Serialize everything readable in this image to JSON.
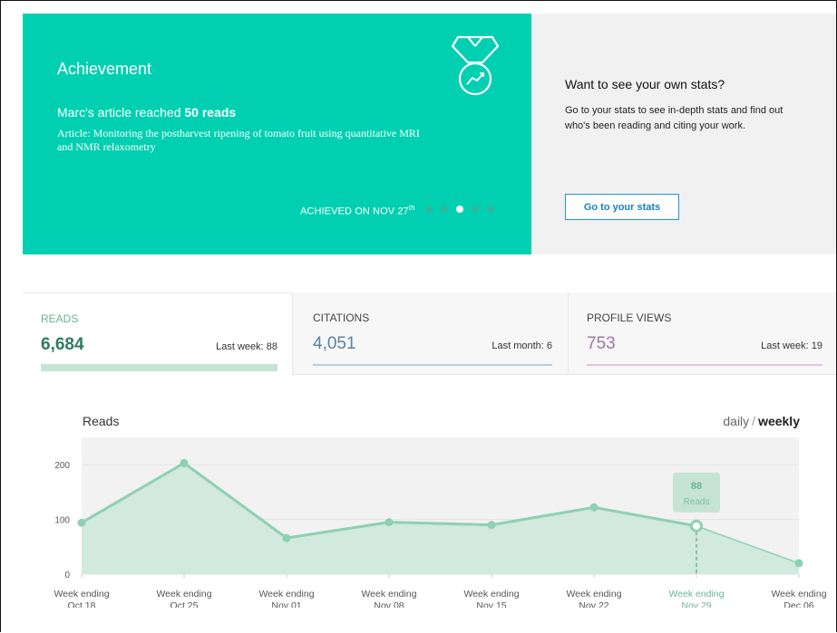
{
  "achievement": {
    "title": "Achievement",
    "headline_prefix": "Marc's article reached ",
    "headline_bold": "50 reads",
    "article": "Article: Monitoring the postharvest ripening of tomato fruit using quantitative MRI and NMR relaxometry",
    "achieved_prefix": "ACHIEVED ON NOV 27",
    "achieved_suffix": "th",
    "slides_total": 5,
    "slide_active": 3,
    "icon": "medal-chart-icon"
  },
  "promo": {
    "title": "Want to see your own stats?",
    "text": "Go to your stats to see in-depth stats and find out who's been reading and citing your work.",
    "button": "Go to your stats"
  },
  "tabs": [
    {
      "label": "READS",
      "value": "6,684",
      "meta": "Last week: 88",
      "color": "#2f7b5f"
    },
    {
      "label": "CITATIONS",
      "value": "4,051",
      "meta": "Last month: 6",
      "color": "#5d7fa2"
    },
    {
      "label": "PROFILE VIEWS",
      "value": "753",
      "meta": "Last week: 19",
      "color": "#a672ad"
    }
  ],
  "chart": {
    "title": "Reads",
    "toggle_daily": "daily",
    "toggle_sep": "/",
    "toggle_weekly": "weekly",
    "tooltip_value": "88",
    "tooltip_label": "Reads"
  },
  "chart_data": {
    "type": "area",
    "title": "Reads",
    "categories": [
      [
        "Week ending",
        "Oct 18"
      ],
      [
        "Week ending",
        "Oct 25"
      ],
      [
        "Week ending",
        "Nov 01"
      ],
      [
        "Week ending",
        "Nov 08"
      ],
      [
        "Week ending",
        "Nov 15"
      ],
      [
        "Week ending",
        "Nov 22"
      ],
      [
        "Week ending",
        "Nov 29"
      ],
      [
        "Week ending",
        "Dec 06"
      ]
    ],
    "values": [
      94,
      203,
      66,
      95,
      90,
      122,
      88,
      20
    ],
    "highlight_index": 6,
    "ylim": [
      0,
      250
    ],
    "yticks": [
      0,
      100,
      200
    ],
    "colors": {
      "line": "#8fd0b3",
      "fill": "#d2e9dd",
      "plot_bg": "#f2f2f2",
      "highlight": "#6cb392"
    }
  }
}
